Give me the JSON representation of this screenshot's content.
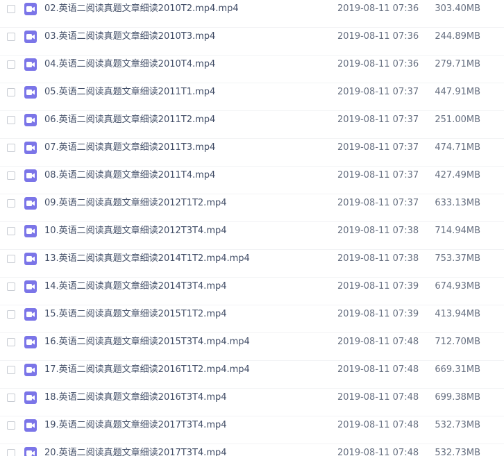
{
  "files": [
    {
      "name": "02.英语二阅读真题文章细读2010T2.mp4.mp4",
      "date": "2019-08-11 07:36",
      "size": "303.40MB",
      "icon": "video-file-icon"
    },
    {
      "name": "03.英语二阅读真题文章细读2010T3.mp4",
      "date": "2019-08-11 07:36",
      "size": "244.89MB",
      "icon": "video-file-icon"
    },
    {
      "name": "04.英语二阅读真题文章细读2010T4.mp4",
      "date": "2019-08-11 07:36",
      "size": "279.71MB",
      "icon": "video-file-icon"
    },
    {
      "name": "05.英语二阅读真题文章细读2011T1.mp4",
      "date": "2019-08-11 07:37",
      "size": "447.91MB",
      "icon": "video-file-icon"
    },
    {
      "name": "06.英语二阅读真题文章细读2011T2.mp4",
      "date": "2019-08-11 07:37",
      "size": "251.00MB",
      "icon": "video-file-icon"
    },
    {
      "name": "07.英语二阅读真题文章细读2011T3.mp4",
      "date": "2019-08-11 07:37",
      "size": "474.71MB",
      "icon": "video-file-icon"
    },
    {
      "name": "08.英语二阅读真题文章细读2011T4.mp4",
      "date": "2019-08-11 07:37",
      "size": "427.49MB",
      "icon": "video-file-icon"
    },
    {
      "name": "09.英语二阅读真题文章细读2012T1T2.mp4",
      "date": "2019-08-11 07:37",
      "size": "633.13MB",
      "icon": "video-file-icon"
    },
    {
      "name": "10.英语二阅读真题文章细读2012T3T4.mp4",
      "date": "2019-08-11 07:38",
      "size": "714.94MB",
      "icon": "video-file-icon"
    },
    {
      "name": "13.英语二阅读真题文章细读2014T1T2.mp4.mp4",
      "date": "2019-08-11 07:38",
      "size": "753.37MB",
      "icon": "video-file-icon"
    },
    {
      "name": "14.英语二阅读真题文章细读2014T3T4.mp4",
      "date": "2019-08-11 07:39",
      "size": "674.93MB",
      "icon": "video-file-icon"
    },
    {
      "name": "15.英语二阅读真题文章细读2015T1T2.mp4",
      "date": "2019-08-11 07:39",
      "size": "413.94MB",
      "icon": "video-file-icon"
    },
    {
      "name": "16.英语二阅读真题文章细读2015T3T4.mp4.mp4",
      "date": "2019-08-11 07:48",
      "size": "712.70MB",
      "icon": "video-file-icon"
    },
    {
      "name": "17.英语二阅读真题文章细读2016T1T2.mp4.mp4",
      "date": "2019-08-11 07:48",
      "size": "669.31MB",
      "icon": "video-file-icon"
    },
    {
      "name": "18.英语二阅读真题文章细读2016T3T4.mp4",
      "date": "2019-08-11 07:48",
      "size": "699.38MB",
      "icon": "video-file-icon"
    },
    {
      "name": "19.英语二阅读真题文章细读2017T3T4.mp4",
      "date": "2019-08-11 07:48",
      "size": "532.73MB",
      "icon": "video-file-icon"
    },
    {
      "name": "20.英语二阅读真题文章细读2017T3T4.mp4",
      "date": "2019-08-11 07:48",
      "size": "532.73MB",
      "icon": "video-file-icon"
    }
  ],
  "colors": {
    "icon_background": "#7b75e8",
    "name_text": "#424e67",
    "meta_text": "#666f80",
    "row_divider": "#f2f3f5"
  }
}
